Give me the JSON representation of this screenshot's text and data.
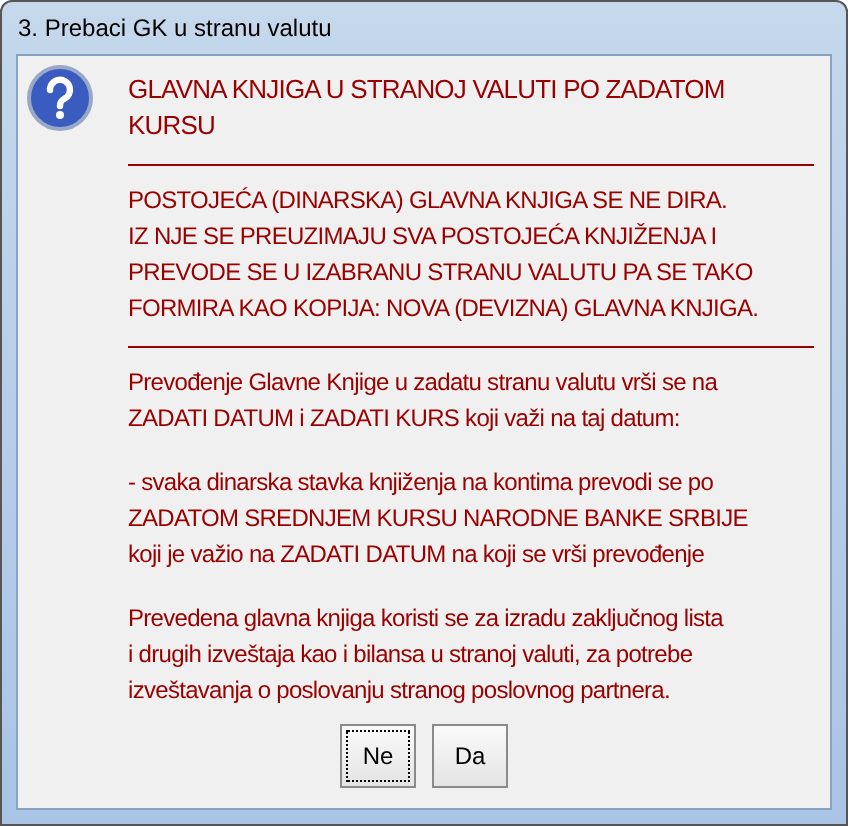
{
  "window": {
    "title": "3. Prebaci GK u stranu valutu"
  },
  "heading": "GLAVNA KNJIGA U STRANOJ VALUTI PO ZADATOM KURSU",
  "sections": [
    {
      "paragraphs": [
        "POSTOJEĆA (DINARSKA) GLAVNA KNJIGA SE NE DIRA.\nIZ NJE SE PREUZIMAJU SVA POSTOJEĆA KNJIŽENJA I\nPREVODE SE U IZABRANU STRANU VALUTU PA SE TAKO\nFORMIRA KAO KOPIJA: NOVA (DEVIZNA) GLAVNA KNJIGA."
      ]
    },
    {
      "paragraphs": [
        "Prevođenje Glavne Knjige u zadatu stranu valutu vrši se na\nZADATI DATUM i ZADATI KURS koji važi na taj datum:",
        "- svaka dinarska stavka knjiženja na kontima prevodi se po\nZADATOM SREDNJEM KURSU NARODNE BANKE SRBIJE\nkoji je važio na ZADATI DATUM na koji se vrši prevođenje",
        "Prevedena glavna knjiga koristi se za izradu zaključnog lista\ni drugih izveštaja kao i bilansa u stranoj valuti, za potrebe\nizveštavanja o poslovanju stranog poslovnog partnera."
      ]
    }
  ],
  "buttons": [
    {
      "label": "Ne",
      "selected": true
    },
    {
      "label": "Da",
      "selected": false
    }
  ]
}
